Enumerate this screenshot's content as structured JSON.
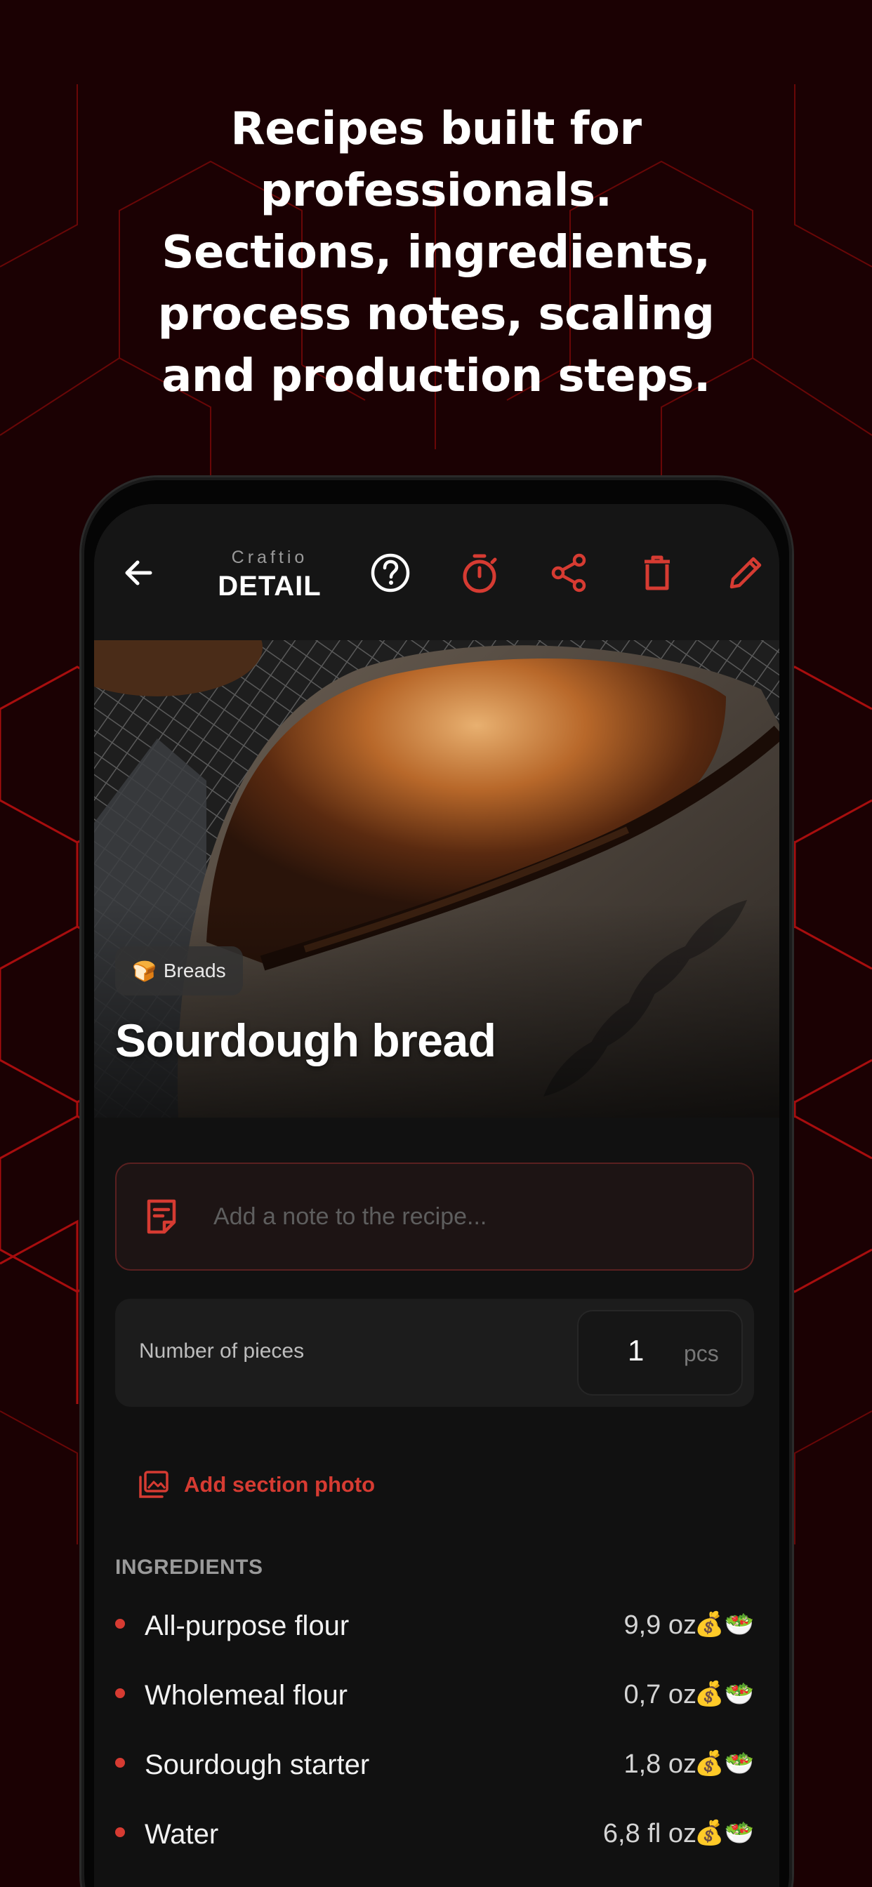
{
  "headline": {
    "lines": [
      "Recipes built for",
      "professionals.",
      "Sections, ingredients,",
      "process notes, scaling",
      "and production steps."
    ]
  },
  "app_bar": {
    "brand": "Craftio",
    "title": "DETAIL",
    "icons": [
      "arrow-left-icon",
      "help-circle-icon",
      "timer-icon",
      "share-icon",
      "trash-icon",
      "pencil-icon"
    ],
    "accent_color": "#d63b32"
  },
  "recipe": {
    "category_emoji": "🍞",
    "category": "Breads",
    "title": "Sourdough bread"
  },
  "note": {
    "placeholder": "Add a note to the recipe..."
  },
  "pieces": {
    "label": "Number of pieces",
    "value": "1",
    "unit": "pcs"
  },
  "section": {
    "add_photo_label": "Add section photo",
    "ingredients_heading": "INGREDIENTS",
    "ingredients": [
      {
        "name": "All-purpose flour",
        "quantity": "9,9 oz",
        "emoji": "💰🥗"
      },
      {
        "name": "Wholemeal flour",
        "quantity": "0,7 oz",
        "emoji": "💰🥗"
      },
      {
        "name": "Sourdough starter",
        "quantity": "1,8 oz",
        "emoji": "💰🥗"
      },
      {
        "name": "Water",
        "quantity": "6,8 fl oz",
        "emoji": "💰🥗"
      }
    ]
  }
}
